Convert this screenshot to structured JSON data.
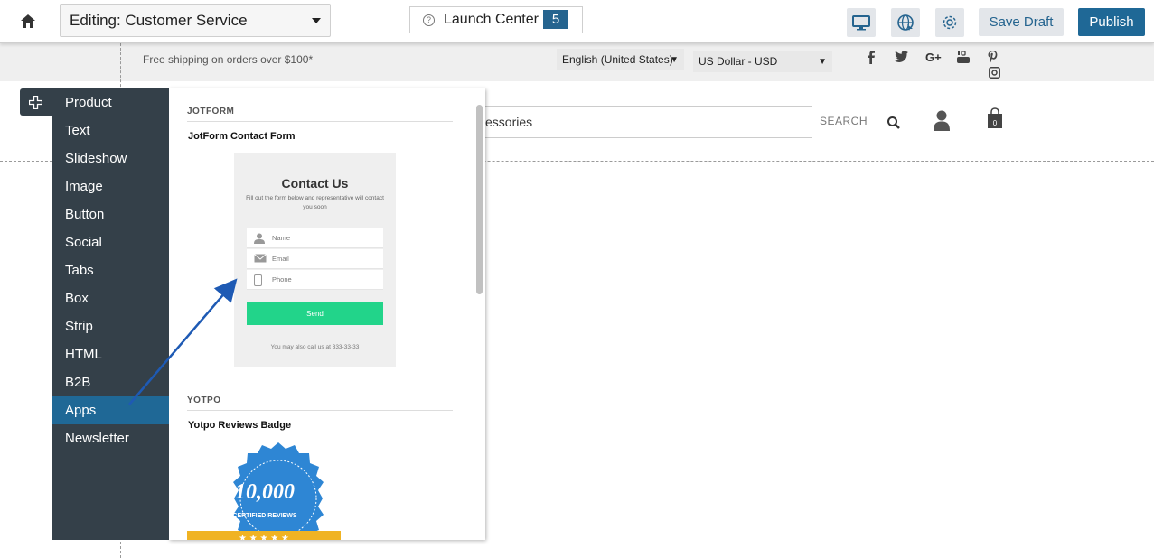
{
  "toolbar": {
    "page_select": "Editing: Customer Service",
    "launch_center": "Launch Center",
    "launch_badge": "5",
    "save_draft": "Save Draft",
    "publish": "Publish",
    "icons": [
      "home-icon",
      "desktop-icon",
      "globe-icon",
      "gear-icon"
    ]
  },
  "store": {
    "announcement": "Free shipping on orders over $100*",
    "language": "English (United States)",
    "currency": "US Dollar - USD",
    "caret": "▼",
    "social": [
      "f",
      "t",
      "G+",
      "You",
      "P",
      "ig"
    ],
    "search_value": "essories",
    "search_label": "SEARCH",
    "cart_count": "0"
  },
  "sidebar": {
    "items": [
      {
        "label": "Product"
      },
      {
        "label": "Text"
      },
      {
        "label": "Slideshow"
      },
      {
        "label": "Image"
      },
      {
        "label": "Button"
      },
      {
        "label": "Social"
      },
      {
        "label": "Tabs"
      },
      {
        "label": "Box"
      },
      {
        "label": "Strip"
      },
      {
        "label": "HTML"
      },
      {
        "label": "B2B"
      },
      {
        "label": "Apps"
      },
      {
        "label": "Newsletter"
      }
    ],
    "active": "Apps"
  },
  "panel": {
    "sections": [
      {
        "label": "JOTFORM",
        "widget": "JotForm Contact Form"
      },
      {
        "label": "YOTPO",
        "widget": "Yotpo Reviews Badge"
      }
    ],
    "contact_form": {
      "title": "Contact Us",
      "subtitle": "Fill out the form below and representative will contact you soon",
      "fields": [
        "Name",
        "Email",
        "Phone"
      ],
      "send": "Send",
      "footer": "You may also call us at 333-33-33"
    },
    "yotpo_badge": {
      "count": "10,000",
      "text": "CERTIFIED REVIEWS"
    }
  },
  "colors": {
    "accent": "#1f6896",
    "sidebar_bg": "#344049",
    "send_green": "#22d48a",
    "badge_blue": "#2e86d4",
    "badge_ribbon": "#f0b323"
  }
}
